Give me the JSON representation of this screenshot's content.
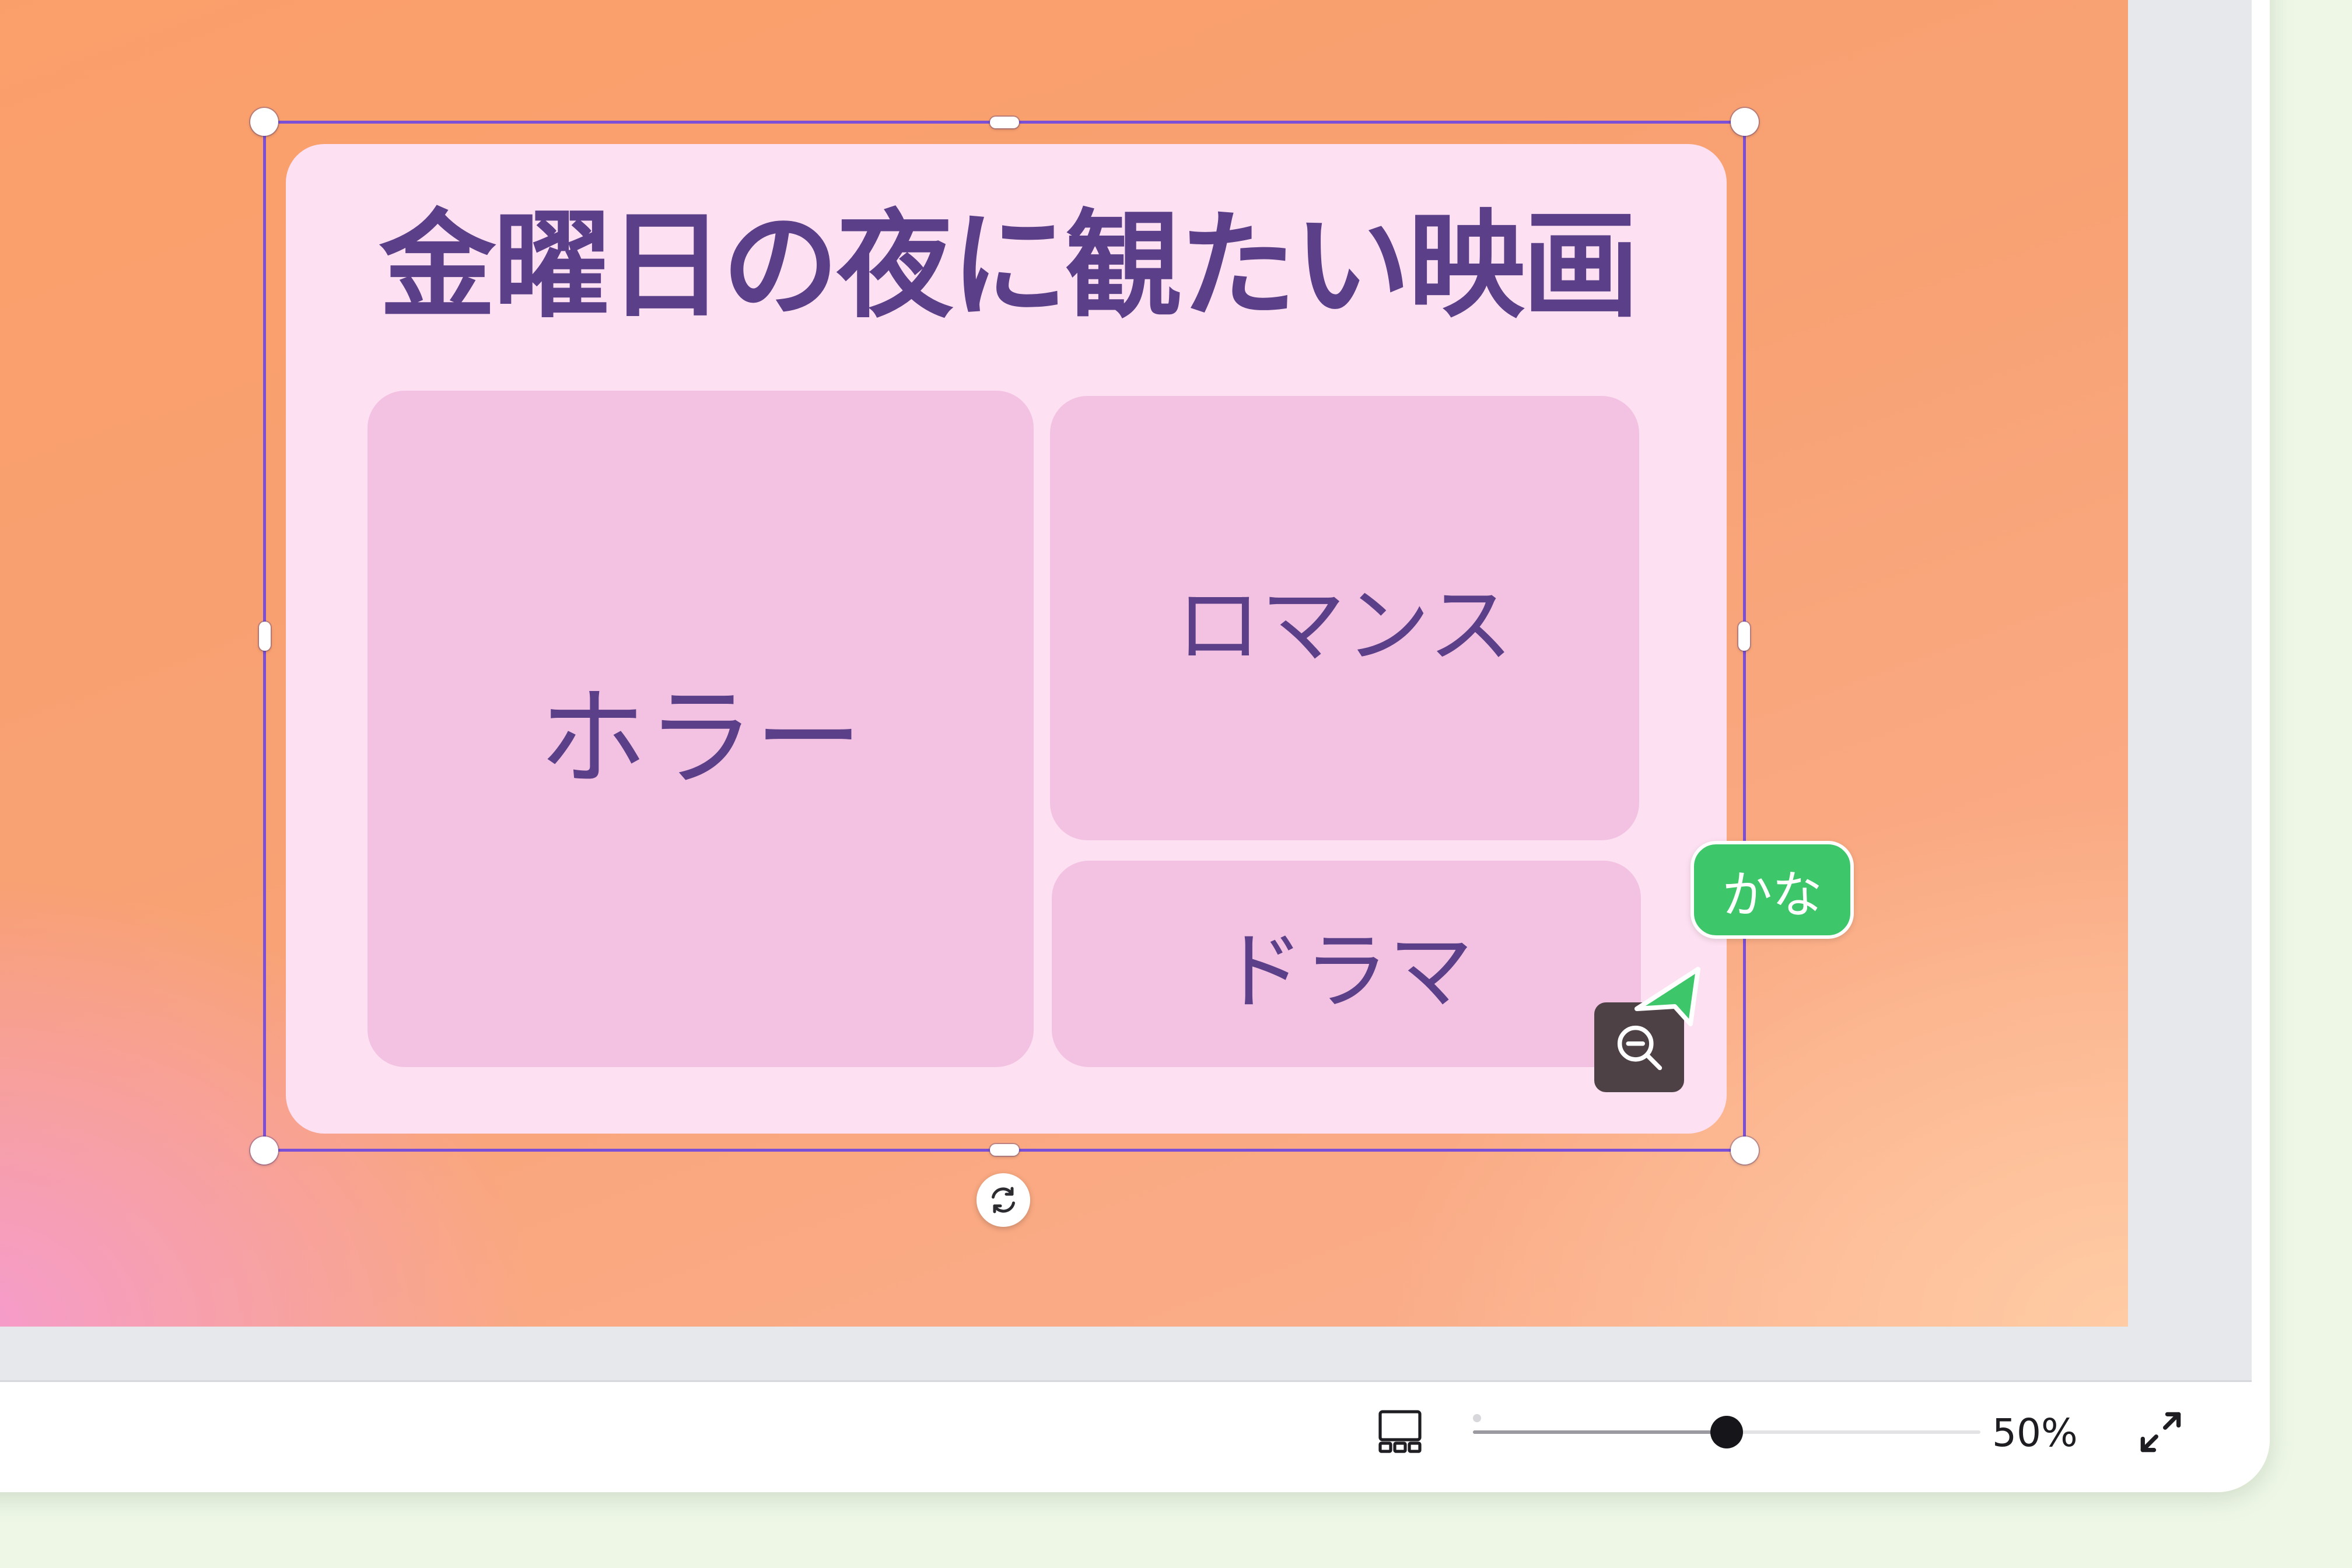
{
  "slide": {
    "title": "金曜日の夜に観たい映画",
    "tiles": {
      "horror": "ホラー",
      "romance": "ロマンス",
      "drama": "ドラマ"
    }
  },
  "collaborator": {
    "name": "かな",
    "color": "#3dc76a"
  },
  "toolbar": {
    "zoom_label": "50%",
    "zoom_fraction": 0.5
  },
  "icons": {
    "rotate": "rotate-icon",
    "zoom_out": "zoom-out-icon",
    "layout": "page-layout-icon",
    "fullscreen": "fullscreen-icon"
  },
  "colors": {
    "accent": "#7b4fd6",
    "title_text": "#5b3f88",
    "card": "#fde0f1",
    "tile": "#f3c2e2"
  }
}
